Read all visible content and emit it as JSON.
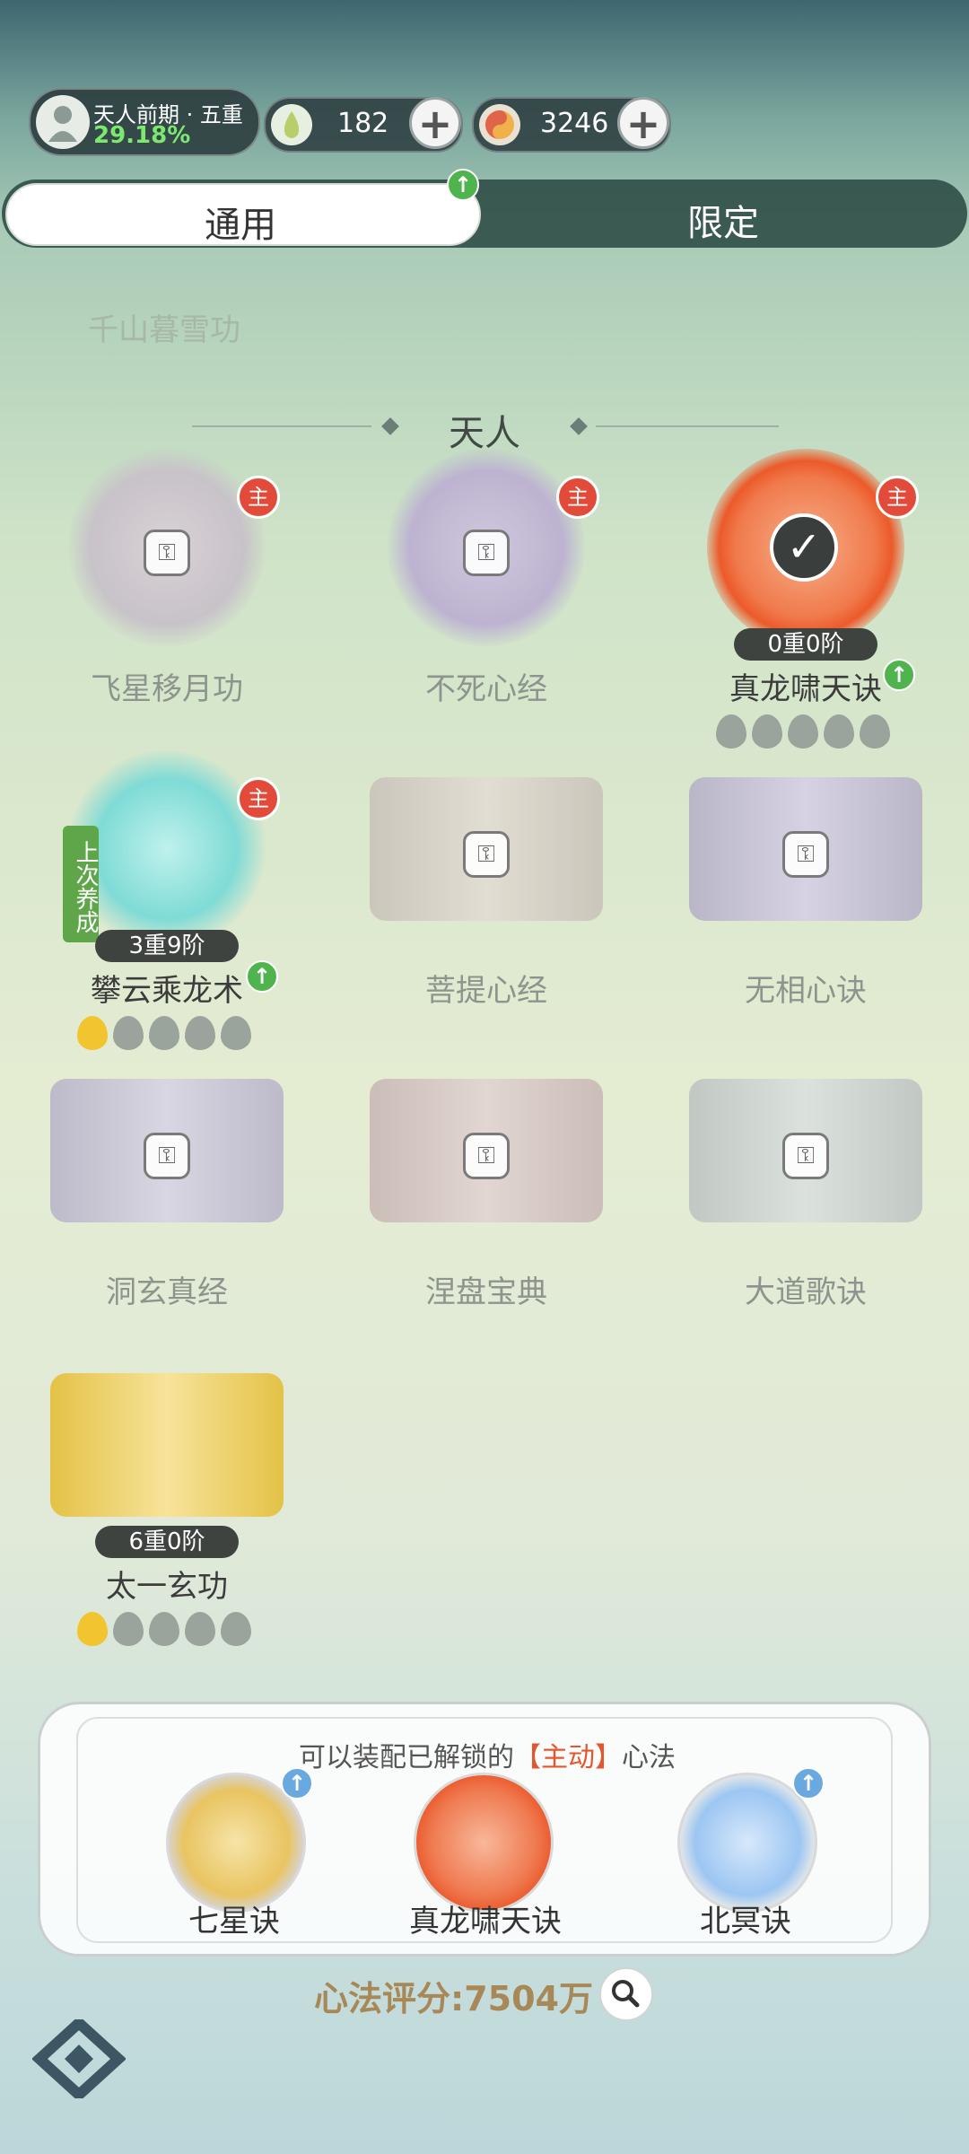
{
  "header": {
    "rank_title": "天人前期 · 五重",
    "rank_percent": "29.18%",
    "resource1_value": "182",
    "resource2_value": "3246",
    "plus": "+"
  },
  "tabs": [
    {
      "label": "通用",
      "active": true
    },
    {
      "label": "限定",
      "active": false
    }
  ],
  "faded_title": "千山暮雪功",
  "section_title": "天人",
  "badge_main": "主",
  "last_trained_tag": "上次养成",
  "items": [
    {
      "name": "飞星移月功",
      "locked": true
    },
    {
      "name": "不死心经",
      "locked": true
    },
    {
      "name": "真龙啸天诀",
      "locked": false,
      "level": "0重0阶",
      "gold_drops": 0
    },
    {
      "name": "攀云乘龙术",
      "locked": false,
      "level": "3重9阶",
      "gold_drops": 1
    },
    {
      "name": "菩提心经",
      "locked": true
    },
    {
      "name": "无相心诀",
      "locked": true
    },
    {
      "name": "洞玄真经",
      "locked": true
    },
    {
      "name": "涅盘宝典",
      "locked": true
    },
    {
      "name": "大道歌诀",
      "locked": true
    },
    {
      "name": "太一玄功",
      "locked": false,
      "level": "6重0阶",
      "gold_drops": 1
    }
  ],
  "equip_panel": {
    "title_prefix": "可以装配已解锁的",
    "title_highlight": "【主动】",
    "title_suffix": "心法",
    "slots": [
      {
        "name": "七星诀"
      },
      {
        "name": "真龙啸天诀"
      },
      {
        "name": "北冥诀"
      }
    ]
  },
  "score": "心法评分:7504万",
  "colors": {
    "accent_green": "#4fb44e",
    "badge_red": "#e24a3a",
    "highlight": "#e4562e",
    "score": "#a88857"
  }
}
